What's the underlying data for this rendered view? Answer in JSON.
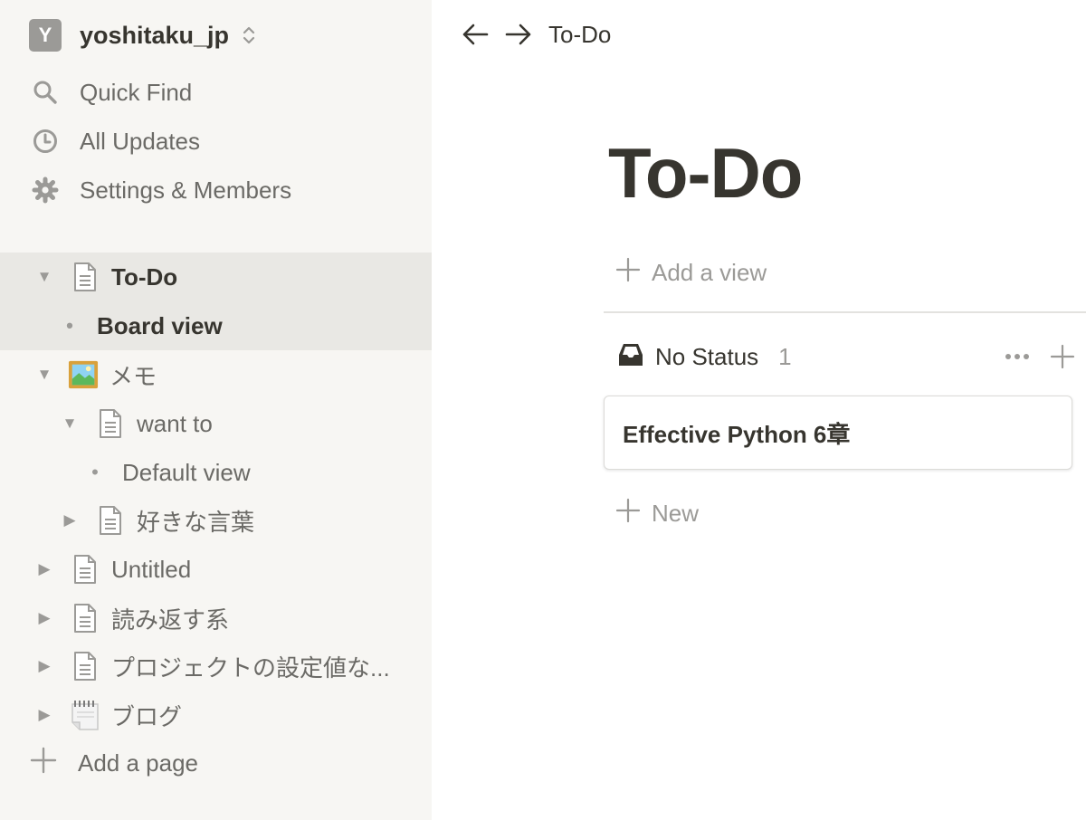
{
  "workspace": {
    "avatar_letter": "Y",
    "name": "yoshitaku_jp"
  },
  "sidebar": {
    "nav": [
      {
        "label": "Quick Find",
        "icon": "search-icon"
      },
      {
        "label": "All Updates",
        "icon": "clock-icon"
      },
      {
        "label": "Settings & Members",
        "icon": "gear-icon"
      }
    ],
    "tree": [
      {
        "label": "To-Do",
        "toggle": "expanded",
        "icon": "page-icon",
        "active": true
      },
      {
        "label": "Board view",
        "icon": "bullet",
        "active": true
      },
      {
        "label": "メモ",
        "toggle": "expanded",
        "icon": "picture-emoji-icon"
      },
      {
        "label": "want to",
        "toggle": "expanded",
        "icon": "page-icon"
      },
      {
        "label": "Default view",
        "icon": "bullet"
      },
      {
        "label": "好きな言葉",
        "toggle": "collapsed",
        "icon": "page-icon"
      },
      {
        "label": "Untitled",
        "toggle": "collapsed",
        "icon": "page-icon"
      },
      {
        "label": "読み返す系",
        "toggle": "collapsed",
        "icon": "page-icon"
      },
      {
        "label": "プロジェクトの設定値な...",
        "toggle": "collapsed",
        "icon": "page-icon"
      },
      {
        "label": "ブログ",
        "toggle": "collapsed",
        "icon": "notepad-emoji-icon"
      }
    ],
    "add_page_label": "Add a page"
  },
  "topbar": {
    "breadcrumb": "To-Do"
  },
  "main": {
    "title": "To-Do",
    "add_view_label": "Add a view",
    "group": {
      "name": "No Status",
      "count": "1"
    },
    "cards": [
      {
        "title": "Effective Python 6章"
      }
    ],
    "new_label": "New"
  },
  "colors": {
    "sidebar_bg": "#f7f6f3",
    "active_row_bg": "#e9e8e4",
    "text_primary": "#37352f",
    "text_secondary": "#6b6a66",
    "text_muted": "#9b9a97"
  }
}
